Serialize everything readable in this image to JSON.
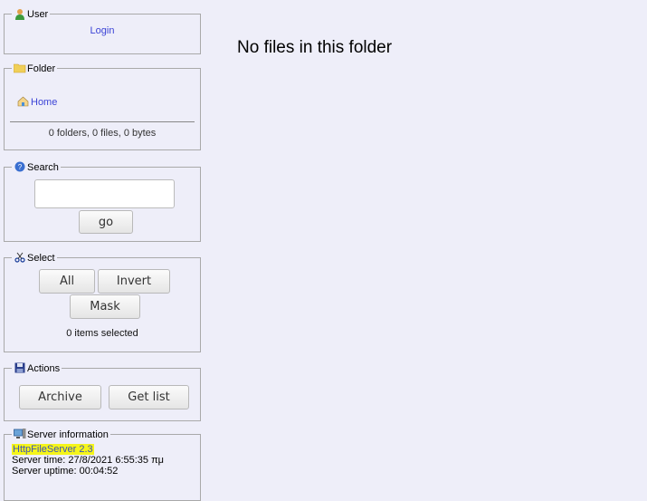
{
  "user": {
    "legend": "User",
    "icon": "user-icon",
    "login_label": "Login"
  },
  "folder": {
    "legend": "Folder",
    "icon": "folder-icon",
    "home_label": "Home",
    "home_icon": "home-icon",
    "summary": "0 folders, 0 files, 0 bytes"
  },
  "search": {
    "legend": "Search",
    "icon": "search-icon",
    "query": "",
    "go_label": "go"
  },
  "select": {
    "legend": "Select",
    "icon": "scissors-icon",
    "all_label": "All",
    "invert_label": "Invert",
    "mask_label": "Mask",
    "selected_text": "0 items selected"
  },
  "actions": {
    "legend": "Actions",
    "icon": "save-icon",
    "archive_label": "Archive",
    "getlist_label": "Get list"
  },
  "server": {
    "legend": "Server information",
    "icon": "server-icon",
    "name": "HttpFileServer 2.3",
    "time": "Server time: 27/8/2021 6:55:35 πμ",
    "uptime": "Server uptime: 00:04:52",
    "highlight_color": "#f5f51a"
  },
  "main": {
    "message": "No files in this folder"
  }
}
